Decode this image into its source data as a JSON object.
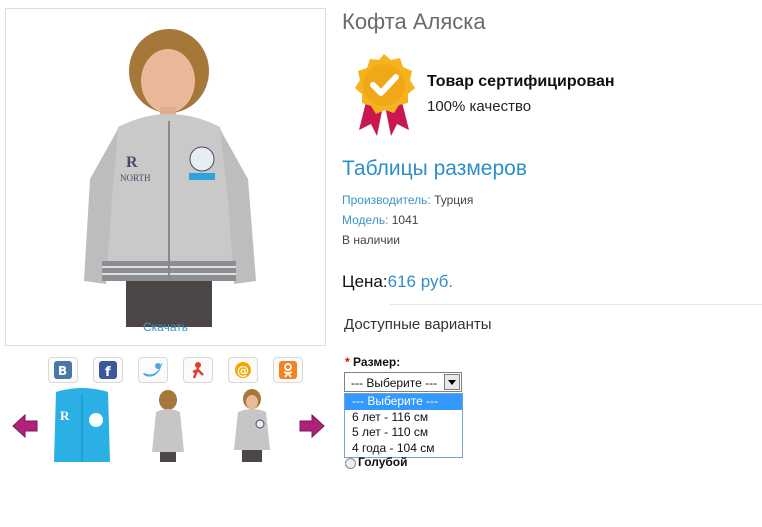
{
  "product": {
    "title": "Кофта Аляска",
    "download_label": "Скачать",
    "certified_title": "Товар сертифицирован",
    "certified_sub": "100% качество",
    "size_table_link": "Таблицы размеров"
  },
  "specs": {
    "manufacturer_label": "Производитель:",
    "manufacturer_value": "Турция",
    "model_label": "Модель:",
    "model_value": "1041",
    "stock": "В наличии"
  },
  "price": {
    "label": "Цена:",
    "value": "616 руб."
  },
  "options": {
    "heading": "Доступные варианты",
    "required_mark": "*",
    "size_label": "Размер:",
    "selected": "--- Выберите ---",
    "items": [
      "--- Выберите ---",
      "6 лет - 116 см",
      "5 лет - 110 см",
      "4 года - 104 см"
    ],
    "color_label": "Голубой"
  },
  "share": {
    "icons": [
      "vkontakte-icon",
      "facebook-icon",
      "twitter-icon",
      "moikrug-icon",
      "mailru-icon",
      "odnoklassniki-icon"
    ]
  },
  "colors": {
    "accent": "#2d8fc8",
    "arrow": "#b0227a",
    "highlight": "#3399ff"
  }
}
